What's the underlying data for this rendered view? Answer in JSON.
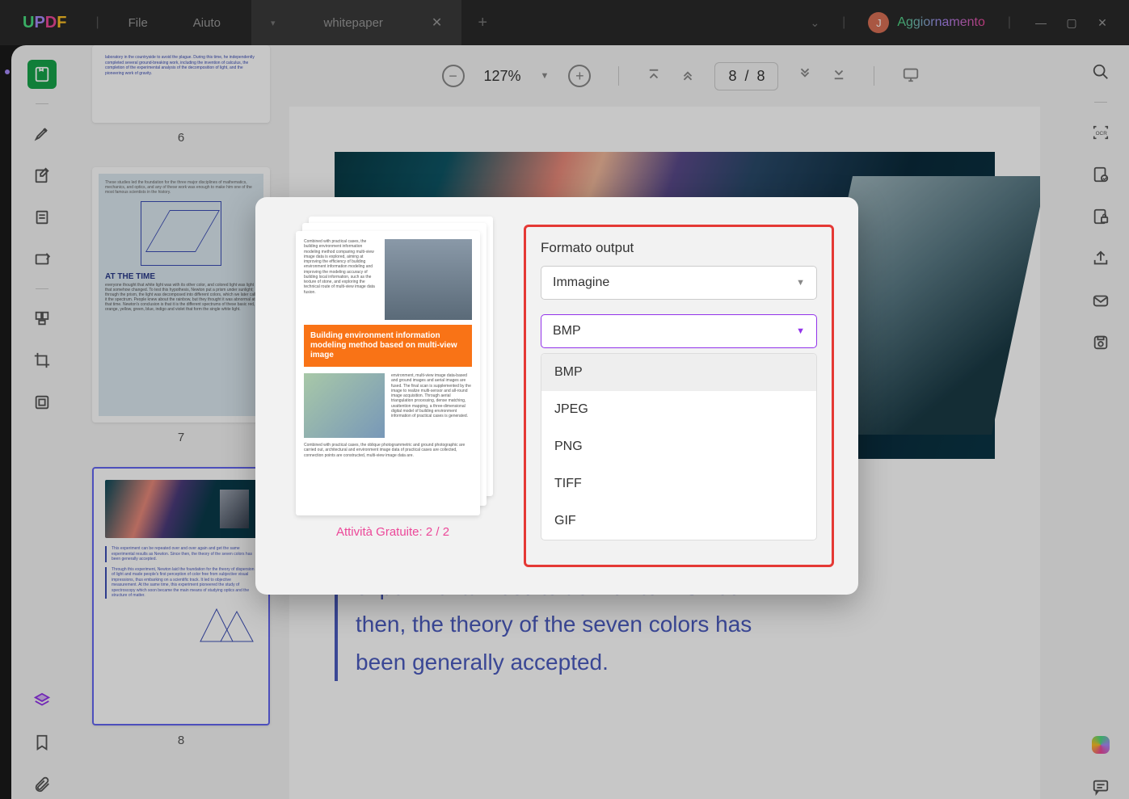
{
  "titlebar": {
    "logo": "UPDF",
    "menu_file": "File",
    "menu_help": "Aiuto",
    "tab_name": "whitepaper",
    "avatar_initial": "J",
    "upgrade": "Aggiornamento"
  },
  "doc_toolbar": {
    "zoom": "127%",
    "page_current": "8",
    "page_total": "8"
  },
  "thumbnails": {
    "p6": "6",
    "p7": "7",
    "p8": "8",
    "t2_heading": "AT THE TIME"
  },
  "document": {
    "paragraph": "over and over again and get the same experimental results as Newton. Since then, the theory of the seven colors has been generally accepted."
  },
  "modal": {
    "quota": "Attività Gratuite: 2 / 2",
    "label_format": "Formato output",
    "select_type": "Immagine",
    "select_format": "BMP",
    "options": {
      "bmp": "BMP",
      "jpeg": "JPEG",
      "png": "PNG",
      "tiff": "TIFF",
      "gif": "GIF"
    },
    "preview_orange": "Building environment information modeling method based on multi-view image"
  }
}
